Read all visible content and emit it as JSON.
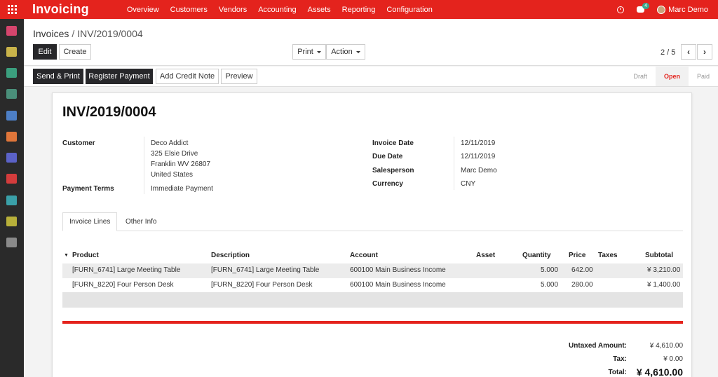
{
  "topbar": {
    "app_title": "Invoicing",
    "menu": [
      "Overview",
      "Customers",
      "Vendors",
      "Accounting",
      "Assets",
      "Reporting",
      "Configuration"
    ],
    "chat_badge": "4",
    "user_name": "Marc Demo",
    "color": "#e4231d"
  },
  "sidebar": {
    "icons": [
      "discuss-icon",
      "calendar-icon",
      "contacts-icon",
      "crm-icon",
      "sales-icon",
      "invoicing-icon",
      "inventory-icon",
      "timesheets-icon",
      "employees-icon",
      "expenses-icon",
      "settings-icon"
    ]
  },
  "breadcrumb": {
    "parent": "Invoices",
    "separator": "/",
    "current": "INV/2019/0004"
  },
  "toolbar": {
    "edit": "Edit",
    "create": "Create",
    "print": "Print",
    "action": "Action",
    "pager": "2 / 5"
  },
  "actions": {
    "send_print": "Send & Print",
    "register_payment": "Register Payment",
    "add_credit_note": "Add Credit Note",
    "preview": "Preview"
  },
  "status": {
    "steps": [
      "Draft",
      "Open",
      "Paid"
    ],
    "active": "Open"
  },
  "invoice": {
    "number": "INV/2019/0004",
    "customer_label": "Customer",
    "customer_lines": [
      "Deco Addict",
      "325 Elsie Drive",
      "Franklin WV 26807",
      "United States"
    ],
    "payment_terms_label": "Payment Terms",
    "payment_terms": "Immediate Payment",
    "invoice_date_label": "Invoice Date",
    "invoice_date": "12/11/2019",
    "due_date_label": "Due Date",
    "due_date": "12/11/2019",
    "salesperson_label": "Salesperson",
    "salesperson": "Marc Demo",
    "currency_label": "Currency",
    "currency": "CNY"
  },
  "tabs": [
    "Invoice Lines",
    "Other Info"
  ],
  "lines": {
    "headers": [
      "Product",
      "Description",
      "Account",
      "Asset",
      "Quantity",
      "Price",
      "Taxes",
      "Subtotal"
    ],
    "rows": [
      {
        "product": "[FURN_6741] Large Meeting Table",
        "description": "[FURN_6741] Large Meeting Table",
        "account": "600100 Main Business Income",
        "asset": "",
        "quantity": "5.000",
        "price": "642.00",
        "taxes": "",
        "subtotal": "¥ 3,210.00"
      },
      {
        "product": "[FURN_8220] Four Person Desk",
        "description": "[FURN_8220] Four Person Desk",
        "account": "600100 Main Business Income",
        "asset": "",
        "quantity": "5.000",
        "price": "280.00",
        "taxes": "",
        "subtotal": "¥ 1,400.00"
      }
    ]
  },
  "totals": {
    "untaxed_label": "Untaxed Amount:",
    "untaxed": "¥ 4,610.00",
    "tax_label": "Tax:",
    "tax": "¥ 0.00",
    "total_label": "Total:",
    "total": "¥ 4,610.00"
  }
}
